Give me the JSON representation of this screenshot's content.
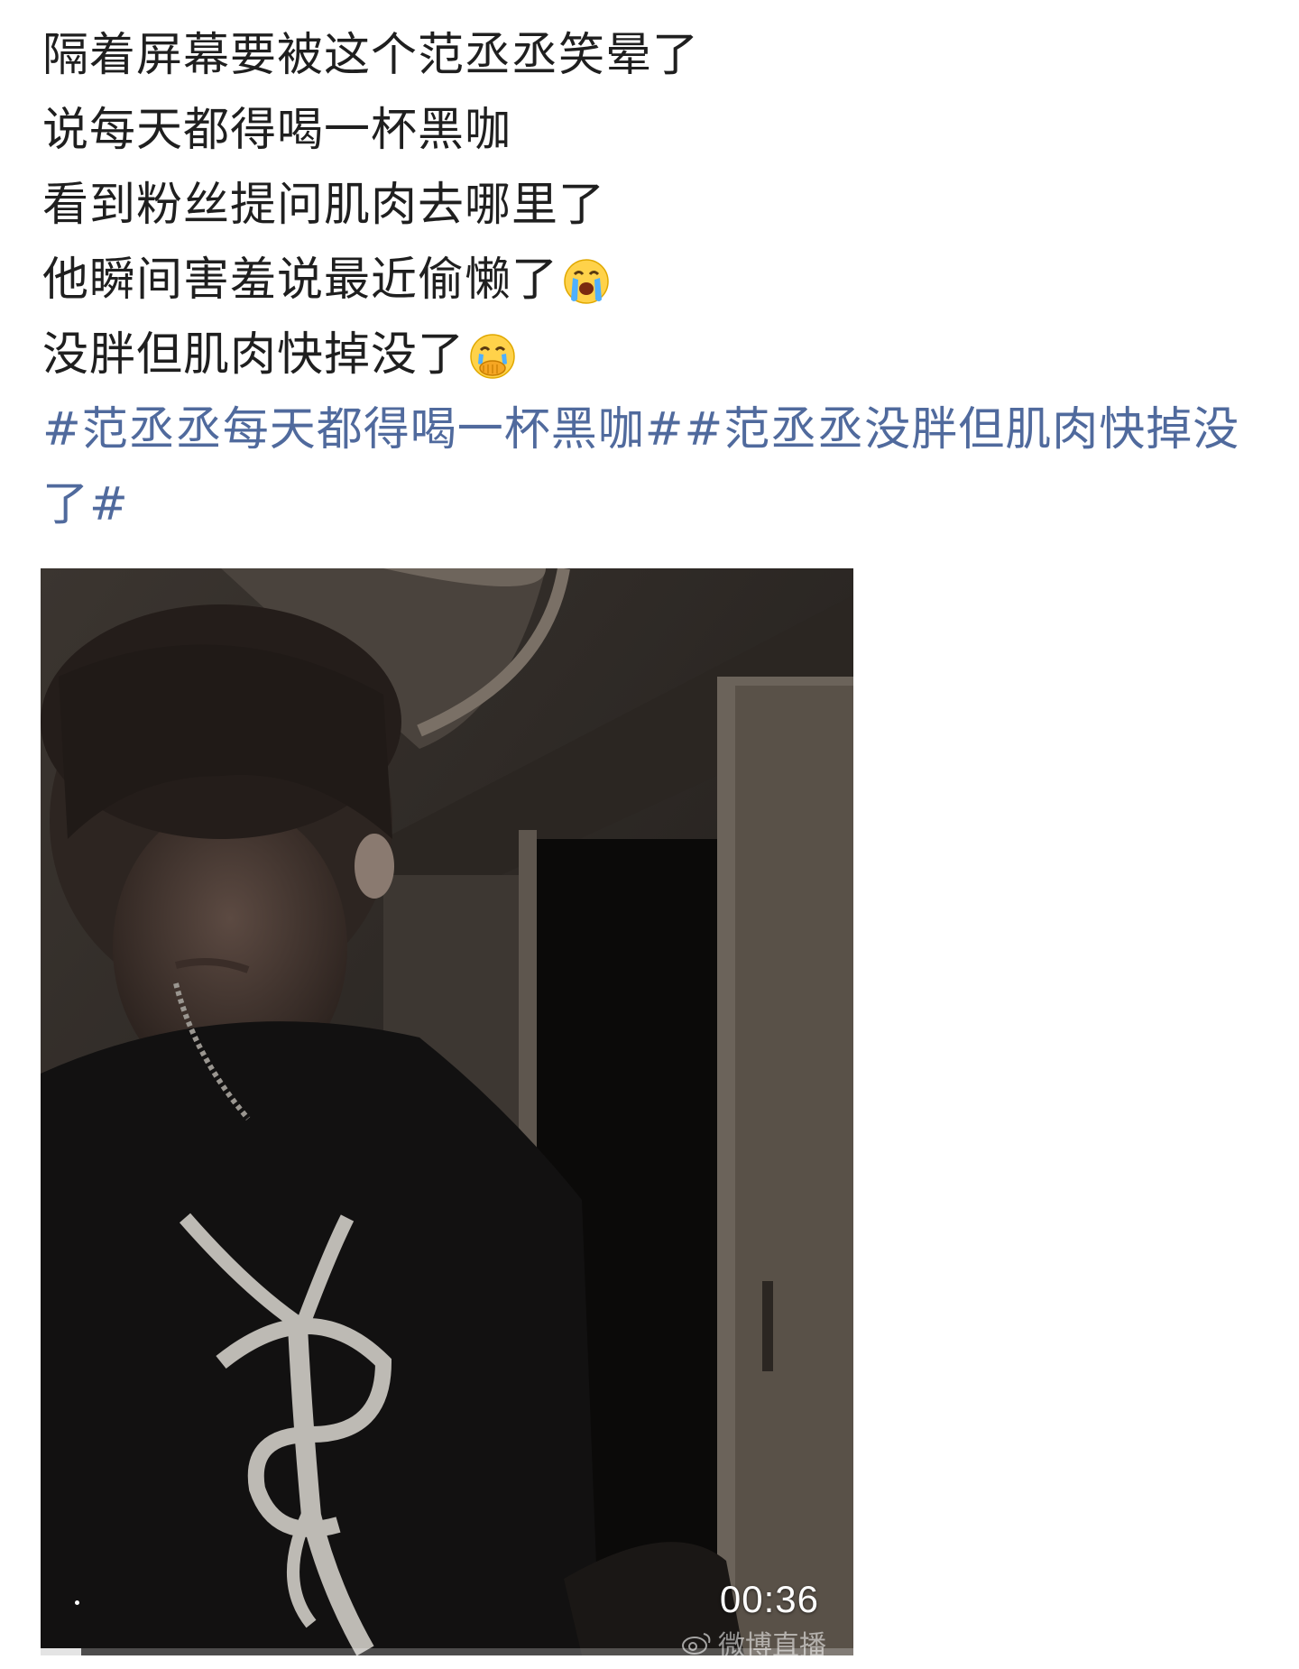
{
  "post": {
    "lines": [
      "隔着屏幕要被这个范丞丞笑晕了",
      "说每天都得喝一杯黑咖",
      "看到粉丝提问肌肉去哪里了",
      "他瞬间害羞说最近偷懒了",
      "没胖但肌肉快掉没了"
    ],
    "emojis": [
      "crying-face",
      "covering-mouth-crying-face"
    ],
    "topics": [
      "#范丞丞每天都得喝一杯黑咖#",
      "#范丞丞没胖但肌肉快掉没了#"
    ],
    "topic_color": "#506a9d"
  },
  "video": {
    "duration": "00:36",
    "watermark": "微博直播",
    "progress": 0.05
  }
}
